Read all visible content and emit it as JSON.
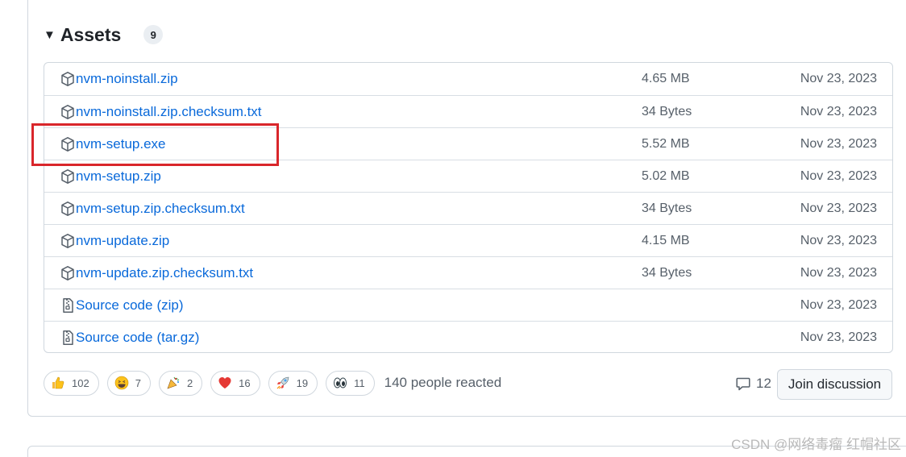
{
  "assets": {
    "title": "Assets",
    "count": "9",
    "items": [
      {
        "name": "nvm-noinstall.zip",
        "extra": "",
        "size": "4.65 MB",
        "date": "Nov 23, 2023",
        "icon": "package-icon"
      },
      {
        "name": "nvm-noinstall.zip.checksum.txt",
        "extra": "",
        "size": "34 Bytes",
        "date": "Nov 23, 2023",
        "icon": "package-icon"
      },
      {
        "name": "nvm-setup.exe",
        "extra": "",
        "size": "5.52 MB",
        "date": "Nov 23, 2023",
        "icon": "package-icon"
      },
      {
        "name": "nvm-setup.zip",
        "extra": "",
        "size": "5.02 MB",
        "date": "Nov 23, 2023",
        "icon": "package-icon"
      },
      {
        "name": "nvm-setup.zip.checksum.txt",
        "extra": "",
        "size": "34 Bytes",
        "date": "Nov 23, 2023",
        "icon": "package-icon"
      },
      {
        "name": "nvm-update.zip",
        "extra": "",
        "size": "4.15 MB",
        "date": "Nov 23, 2023",
        "icon": "package-icon"
      },
      {
        "name": "nvm-update.zip.checksum.txt",
        "extra": "",
        "size": "34 Bytes",
        "date": "Nov 23, 2023",
        "icon": "package-icon"
      },
      {
        "name": "Source code",
        "extra": "(zip)",
        "size": "",
        "date": "Nov 23, 2023",
        "icon": "file-zip-icon"
      },
      {
        "name": "Source code",
        "extra": "(tar.gz)",
        "size": "",
        "date": "Nov 23, 2023",
        "icon": "file-zip-icon"
      }
    ]
  },
  "reactions": {
    "items": [
      {
        "emoji": "thumbs-up-icon",
        "count": "102"
      },
      {
        "emoji": "laugh-icon",
        "count": "7"
      },
      {
        "emoji": "hooray-icon",
        "count": "2"
      },
      {
        "emoji": "heart-icon",
        "count": "16"
      },
      {
        "emoji": "rocket-icon",
        "count": "19"
      },
      {
        "emoji": "eyes-icon",
        "count": "11"
      }
    ],
    "summary": "140 people reacted"
  },
  "discussion": {
    "comment_count": "12",
    "join_label": "Join discussion"
  },
  "watermark": "CSDN @网络毒瘤 红帽社区",
  "colors": {
    "link": "#0969da",
    "muted": "#57606a",
    "highlight": "#d9262b",
    "border": "#d0d7de"
  }
}
